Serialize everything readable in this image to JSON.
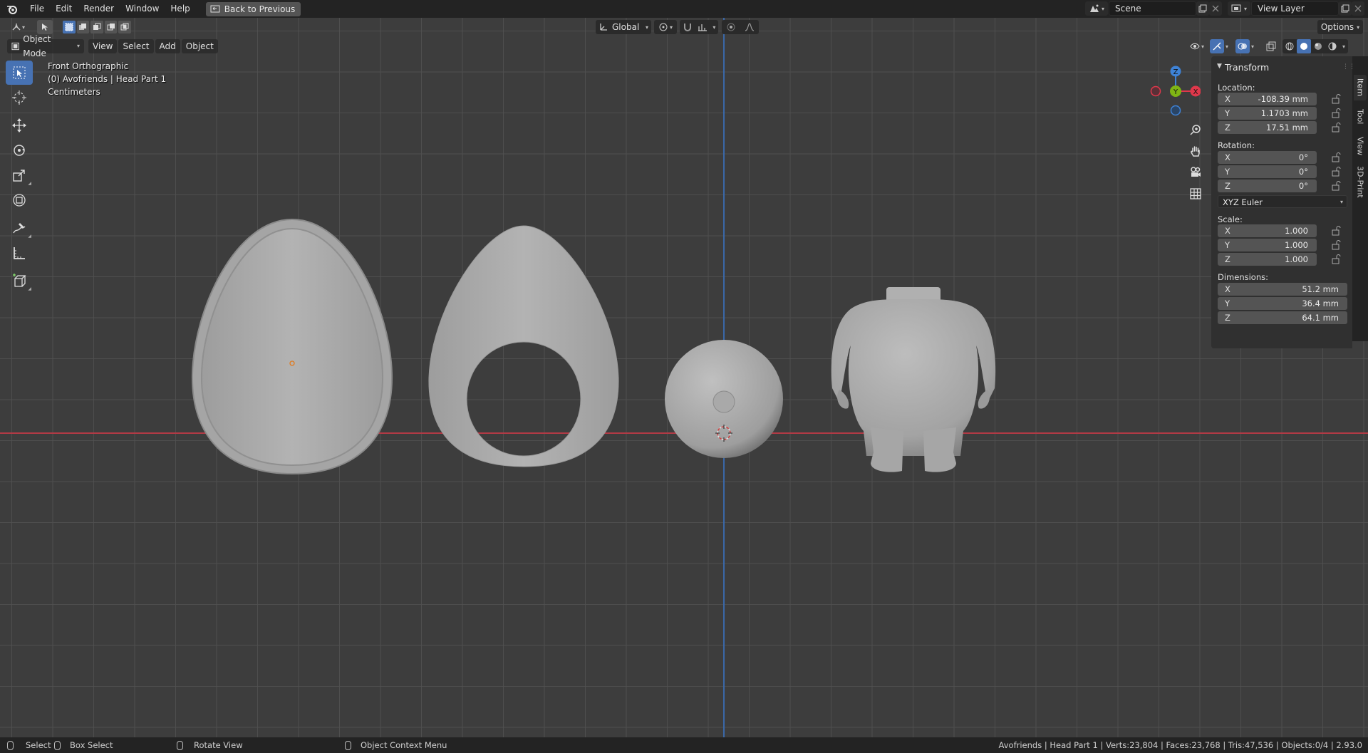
{
  "menubar": {
    "items": [
      "File",
      "Edit",
      "Render",
      "Window",
      "Help"
    ],
    "back_button": "Back to Previous",
    "scene": "Scene",
    "view_layer": "View Layer"
  },
  "viewport_header": {
    "mode": "Object Mode",
    "menus": [
      "View",
      "Select",
      "Add",
      "Object"
    ],
    "transform_orientation": "Global",
    "options": "Options"
  },
  "overlay": {
    "view_name": "Front Orthographic",
    "object_info": "(0) Avofriends | Head Part 1",
    "units": "Centimeters"
  },
  "gizmo": {
    "z": "Z",
    "y": "Y",
    "x": "X"
  },
  "panel": {
    "title": "Transform",
    "location_label": "Location:",
    "location": [
      {
        "axis": "X",
        "value": "-108.39 mm"
      },
      {
        "axis": "Y",
        "value": "1.1703 mm"
      },
      {
        "axis": "Z",
        "value": "17.51 mm"
      }
    ],
    "rotation_label": "Rotation:",
    "rotation": [
      {
        "axis": "X",
        "value": "0°"
      },
      {
        "axis": "Y",
        "value": "0°"
      },
      {
        "axis": "Z",
        "value": "0°"
      }
    ],
    "rotation_mode": "XYZ Euler",
    "scale_label": "Scale:",
    "scale": [
      {
        "axis": "X",
        "value": "1.000"
      },
      {
        "axis": "Y",
        "value": "1.000"
      },
      {
        "axis": "Z",
        "value": "1.000"
      }
    ],
    "dimensions_label": "Dimensions:",
    "dimensions": [
      {
        "axis": "X",
        "value": "51.2 mm"
      },
      {
        "axis": "Y",
        "value": "36.4 mm"
      },
      {
        "axis": "Z",
        "value": "64.1 mm"
      }
    ],
    "tabs": [
      "Item",
      "Tool",
      "View",
      "3D-Print"
    ]
  },
  "statusbar": {
    "select": "Select",
    "box_select": "Box Select",
    "rotate_view": "Rotate View",
    "context_menu": "Object Context Menu",
    "stats": "Avofriends | Head Part 1 | Verts:23,804 | Faces:23,768 | Tris:47,536 | Objects:0/4 | 2.93.0"
  },
  "colors": {
    "accent": "#4772b3",
    "axis_x": "#e0384b",
    "axis_y": "#7fb514",
    "axis_z": "#3e82d6"
  }
}
